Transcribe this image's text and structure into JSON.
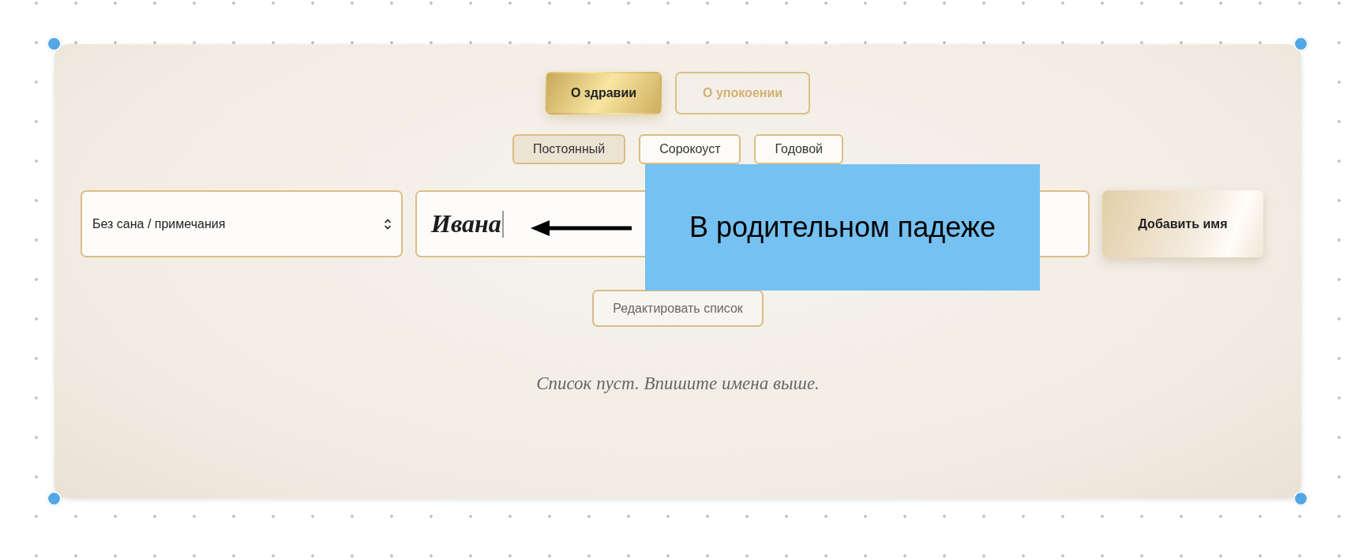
{
  "prayer_tabs": [
    {
      "label": "О здравии",
      "selected": true
    },
    {
      "label": "О упокоении",
      "selected": false
    }
  ],
  "period_tabs": [
    {
      "label": "Постоянный",
      "selected": true
    },
    {
      "label": "Сорокоуст",
      "selected": false
    },
    {
      "label": "Годовой",
      "selected": false
    }
  ],
  "rank_select": {
    "value": "Без сана / примечания"
  },
  "name_field": {
    "value": "Ивана"
  },
  "add_button": "Добавить имя",
  "edit_button": "Редактировать список",
  "empty_message": "Список пуст. Впишите имена выше.",
  "callout": {
    "text": "В родительном падеже"
  }
}
